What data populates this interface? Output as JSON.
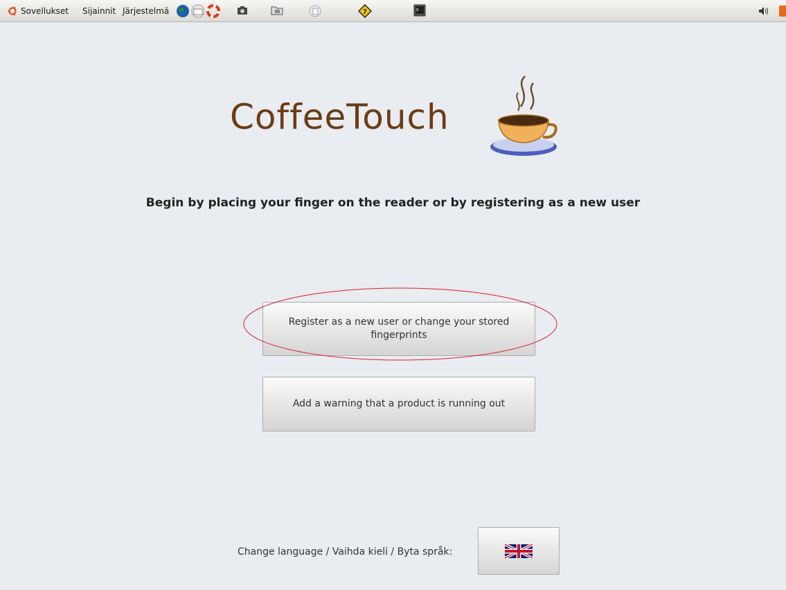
{
  "panel": {
    "menus": [
      "Sovellukset",
      "Sijainnit",
      "Järjestelmä"
    ],
    "icons": [
      "globe-icon",
      "mail-icon",
      "help-lifebuoy-icon",
      "screenshot-icon",
      "file-manager-icon",
      "text-editor-icon",
      "update-icon",
      "terminal-icon"
    ],
    "volume_icon": "volume-icon"
  },
  "app": {
    "title": "CoffeeTouch",
    "instructions": "Begin by placing your finger on the reader or by registering as a new user",
    "register_label": "Register as a new user or change your stored fingerprints",
    "warning_label": "Add a warning that a product is running out",
    "language_label": "Change language / Vaihda kieli / Byta språk:",
    "language_flag": "uk-flag-icon"
  },
  "colors": {
    "title": "#6a3c15",
    "highlight_circle": "#d8202a",
    "background": "#e9ecf0"
  }
}
